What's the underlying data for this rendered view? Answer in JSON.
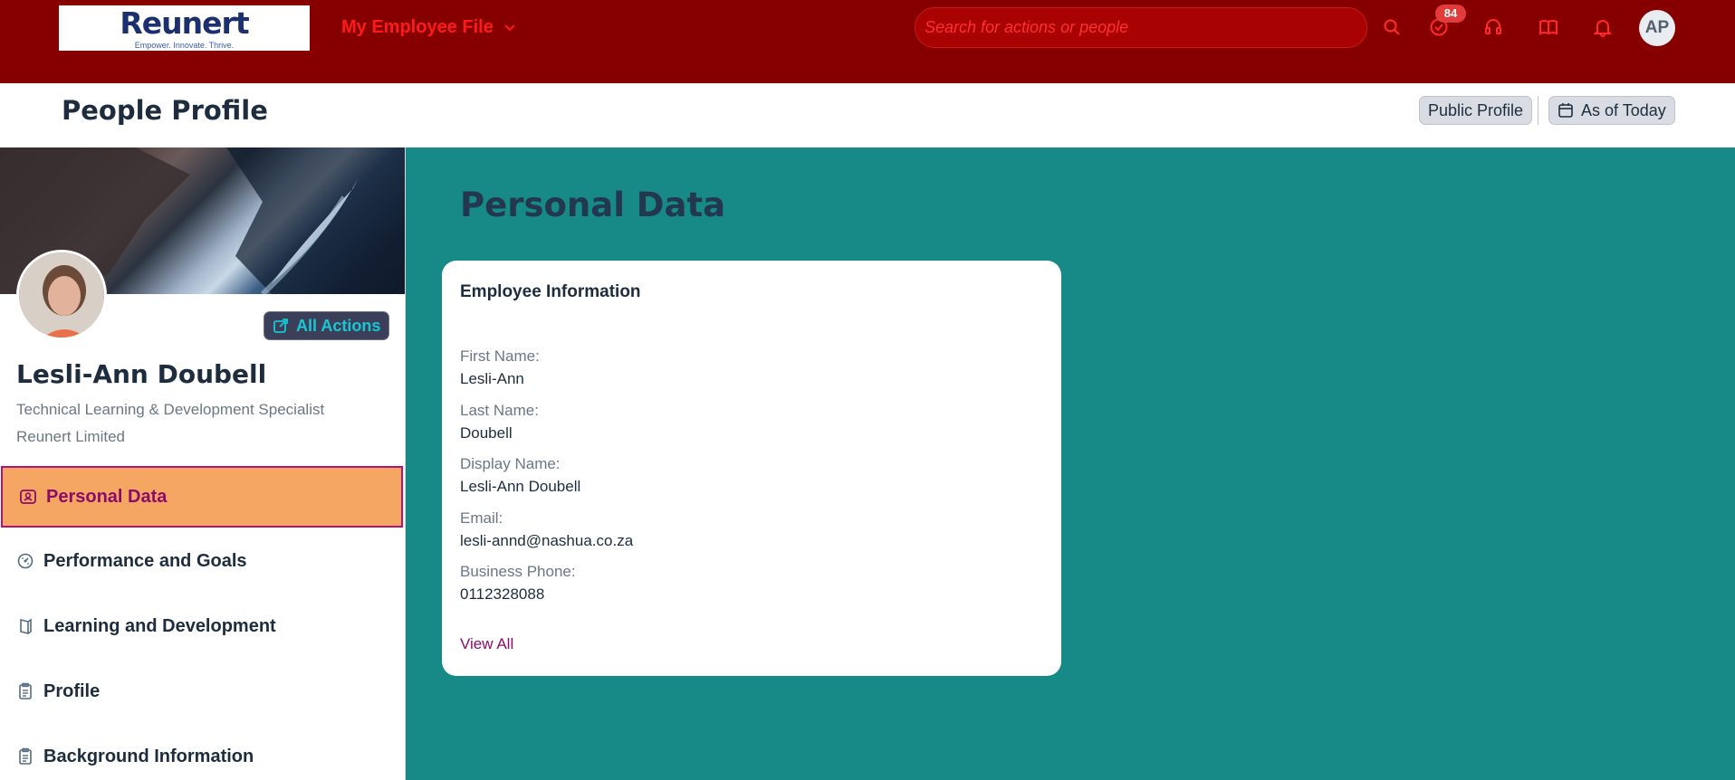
{
  "shell": {
    "logo": {
      "word": "Reunert",
      "tagline": "Empower. Innovate. Thrive."
    },
    "app_title": "My Employee File",
    "search": {
      "placeholder": "Search for actions or people"
    },
    "notification_badge": "84",
    "user_initials": "AP",
    "colors": {
      "bar": "#870000",
      "title": "#ff1a1a"
    },
    "icons": [
      "search-icon",
      "tasks-check-icon",
      "headset-icon",
      "book-icon",
      "bell-icon"
    ]
  },
  "header": {
    "title": "People Profile",
    "public_profile_label": "Public Profile",
    "as_of_label": "As of Today"
  },
  "profile": {
    "name": "Lesli-Ann Doubell",
    "job_title": "Technical Learning & Development Specialist",
    "company": "Reunert Limited",
    "all_actions_label": "All Actions"
  },
  "nav": {
    "items": [
      {
        "label": "Personal Data",
        "icon": "person-card-icon",
        "selected": true
      },
      {
        "label": "Performance and Goals",
        "icon": "performance-icon",
        "selected": false
      },
      {
        "label": "Learning and Development",
        "icon": "learning-icon",
        "selected": false
      },
      {
        "label": "Profile",
        "icon": "clipboard-icon",
        "selected": false
      },
      {
        "label": "Background Information",
        "icon": "clipboard-icon",
        "selected": false
      }
    ]
  },
  "section": {
    "title": "Personal Data",
    "card": {
      "title": "Employee Information",
      "fields": [
        {
          "label": "First Name:",
          "value": "Lesli-Ann"
        },
        {
          "label": "Last Name:",
          "value": "Doubell"
        },
        {
          "label": "Display Name:",
          "value": "Lesli-Ann Doubell"
        },
        {
          "label": "Email:",
          "value": "lesli-annd@nashua.co.za"
        },
        {
          "label": "Business Phone:",
          "value": "0112328088"
        }
      ],
      "view_all_label": "View All"
    },
    "background_color": "#178a88"
  }
}
